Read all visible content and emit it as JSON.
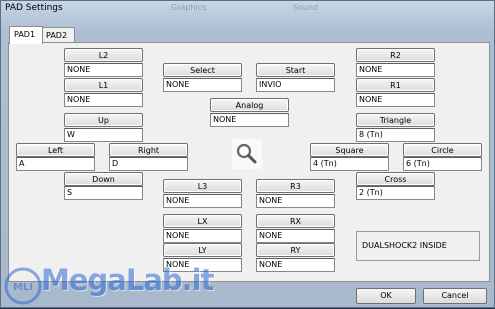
{
  "window": {
    "title": "PAD Settings",
    "ghost_left": "Graphics",
    "ghost_right": "Sound"
  },
  "tabs": [
    {
      "label": "PAD1"
    },
    {
      "label": "PAD2"
    }
  ],
  "controls": {
    "l2": {
      "label": "L2",
      "value": "NONE"
    },
    "l1": {
      "label": "L1",
      "value": "NONE"
    },
    "select": {
      "label": "Select",
      "value": "NONE"
    },
    "start": {
      "label": "Start",
      "value": "INVIO"
    },
    "r2": {
      "label": "R2",
      "value": "NONE"
    },
    "r1": {
      "label": "R1",
      "value": "NONE"
    },
    "analog": {
      "label": "Analog",
      "value": "NONE"
    },
    "up": {
      "label": "Up",
      "value": "W"
    },
    "triangle": {
      "label": "Triangle",
      "value": "8 (Tn)"
    },
    "left": {
      "label": "Left",
      "value": "A"
    },
    "right": {
      "label": "Right",
      "value": "D"
    },
    "square": {
      "label": "Square",
      "value": "4 (Tn)"
    },
    "circle": {
      "label": "Circle",
      "value": "6 (Tn)"
    },
    "down": {
      "label": "Down",
      "value": "S"
    },
    "cross": {
      "label": "Cross",
      "value": "2 (Tn)"
    },
    "l3": {
      "label": "L3",
      "value": "NONE"
    },
    "r3": {
      "label": "R3",
      "value": "NONE"
    },
    "lx": {
      "label": "LX",
      "value": "NONE"
    },
    "rx": {
      "label": "RX",
      "value": "NONE"
    },
    "ly": {
      "label": "LY",
      "value": "NONE"
    },
    "ry": {
      "label": "RY",
      "value": "NONE"
    }
  },
  "info": {
    "text": "DUALSHOCK2 INSIDE"
  },
  "dialog": {
    "ok_label": "OK",
    "cancel_label": "Cancel"
  },
  "watermark": {
    "text": "MegaLab.it",
    "badge": "MLI"
  }
}
